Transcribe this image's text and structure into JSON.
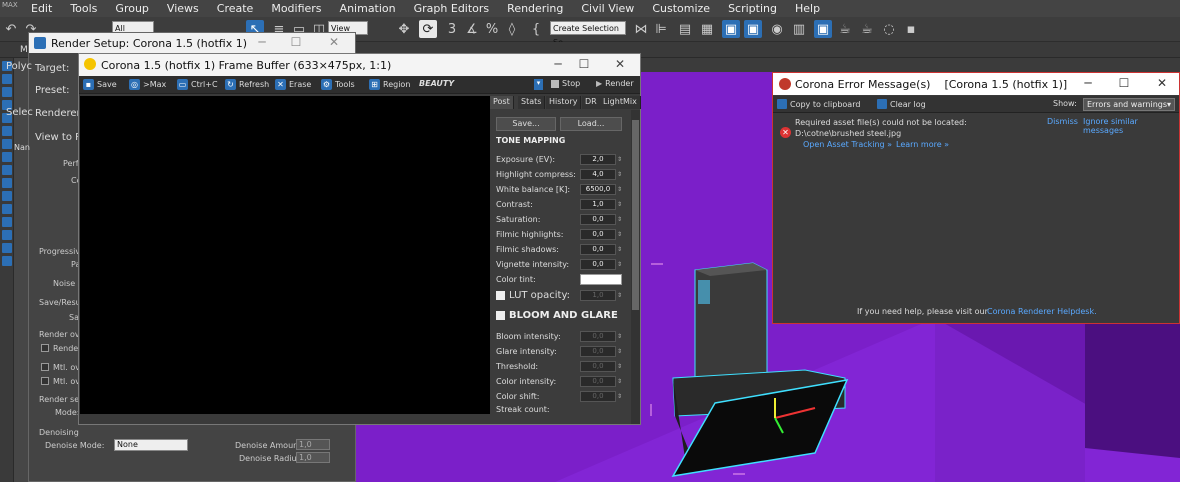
{
  "app": {
    "logo_text": "MAX"
  },
  "menubar": [
    "Edit",
    "Tools",
    "Group",
    "Views",
    "Create",
    "Modifiers",
    "Animation",
    "Graph Editors",
    "Rendering",
    "Civil View",
    "Customize",
    "Scripting",
    "Help"
  ],
  "toolbar": {
    "selection_filter": "All",
    "view_dropdown": "View",
    "selection_set": "Create Selection Se"
  },
  "render_setup": {
    "title": "Render Setup: Corona 1.5 (hotfix 1)",
    "labels": {
      "target": "Target:",
      "preset": "Preset:",
      "renderer": "Renderer:",
      "view_to_render": "View to Ren"
    },
    "fragments": [
      "Perf",
      "Co",
      "Progressive",
      "Pa",
      "Noise le",
      "Save/Resum",
      "Sa",
      "Render over",
      "Render l",
      "Mtl. over",
      "Mtl. over",
      "Render sele",
      "Mode:"
    ],
    "denoising": {
      "header": "Denoising",
      "mode_label": "Denoise Mode:",
      "mode_value": "None",
      "amount_label": "Denoise Amount:",
      "amount_value": "1,0",
      "radius_label": "Denoise Radius:",
      "radius_value": "1,0"
    },
    "side_fragments": {
      "polygon": "Polyc",
      "select": "Selec",
      "name": "Nan",
      "m": "M"
    }
  },
  "frame_buffer": {
    "title": "Corona 1.5 (hotfix 1) Frame Buffer (633×475px, 1:1)",
    "toolbar": [
      "Save",
      ">Max",
      "Ctrl+C",
      "Refresh",
      "Erase",
      "Tools",
      "Region"
    ],
    "channel": "BEAUTY",
    "stop_label": "Stop",
    "render_label": "Render",
    "tabs": [
      "Post",
      "Stats",
      "History",
      "DR",
      "LightMix"
    ],
    "save_btn": "Save...",
    "load_btn": "Load...",
    "tone_mapping": {
      "header": "TONE MAPPING",
      "params": [
        {
          "label": "Exposure (EV):",
          "value": "2,0"
        },
        {
          "label": "Highlight compress:",
          "value": "4,0"
        },
        {
          "label": "White balance [K]:",
          "value": "6500,0"
        },
        {
          "label": "Contrast:",
          "value": "1,0"
        },
        {
          "label": "Saturation:",
          "value": "0,0"
        },
        {
          "label": "Filmic highlights:",
          "value": "0,0"
        },
        {
          "label": "Filmic shadows:",
          "value": "0,0"
        },
        {
          "label": "Vignette intensity:",
          "value": "0,0"
        }
      ],
      "color_tint_label": "Color tint:",
      "color_tint": "#ffffff",
      "lut_label": "LUT opacity:",
      "lut_value": "1,0"
    },
    "bloom_glare": {
      "header": "BLOOM AND GLARE",
      "params": [
        {
          "label": "Bloom intensity:",
          "value": "0,0"
        },
        {
          "label": "Glare intensity:",
          "value": "0,0"
        },
        {
          "label": "Threshold:",
          "value": "0,0"
        },
        {
          "label": "Color intensity:",
          "value": "0,0"
        },
        {
          "label": "Color shift:",
          "value": "0,0"
        },
        {
          "label": "Streak count:",
          "value": ""
        }
      ]
    }
  },
  "error_window": {
    "title": "Corona Error Message(s)    [Corona 1.5 (hotfix 1)]",
    "copy_label": "Copy to clipboard",
    "clear_label": "Clear log",
    "show_label": "Show:",
    "show_value": "Errors and warnings",
    "message_line1": "Required asset file(s) could not be located:",
    "message_line2": "D:\\cotne\\brushed steel.jpg",
    "dismiss": "Dismiss",
    "ignore_similar": "Ignore similar messages",
    "open_tracking": "Open Asset Tracking »",
    "learn_more": "Learn more »",
    "help_text": "If you need help, please visit our",
    "helpdesk_link": "Corona Renderer Helpdesk."
  },
  "colors": {
    "viewport": "#7b1fc9",
    "accent": "#2c6fb5",
    "link": "#5aa9ff",
    "error": "#cc3333"
  }
}
